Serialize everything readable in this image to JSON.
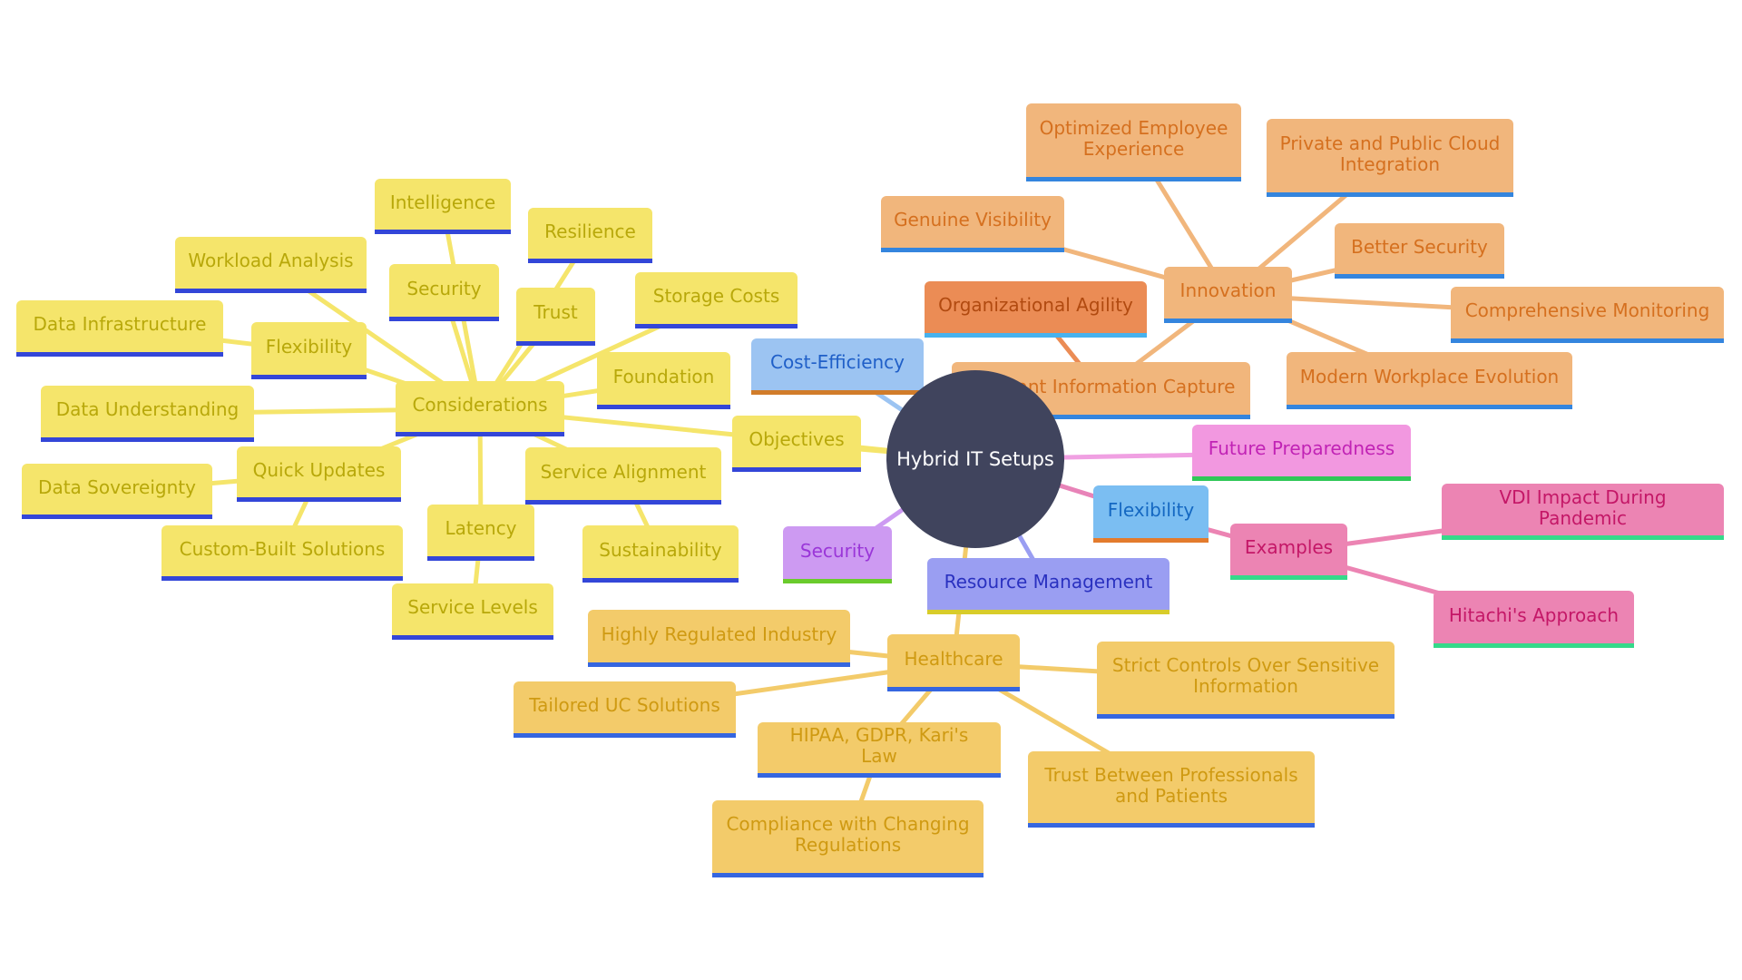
{
  "root": {
    "label": "Hybrid IT Setups"
  },
  "palette": {
    "yellow": {
      "fill": "#f5e56b",
      "text": "#b8a80a",
      "border": "#3346d8",
      "edge": "#f5e56b"
    },
    "gold": {
      "fill": "#f3cb6a",
      "text": "#cf9a12",
      "border": "#3566e0",
      "edge": "#f3cb6a"
    },
    "peach": {
      "fill": "#f1b67c",
      "text": "#d5701f",
      "border": "#3485de",
      "edge": "#f1b67c"
    },
    "orange": {
      "fill": "#eb8c55",
      "text": "#b14a10",
      "border": "#47b2ee",
      "edge": "#eb8c55"
    },
    "lightblue": {
      "fill": "#9cc4f2",
      "text": "#1f5fc8",
      "border": "#d17c2a",
      "edge": "#9cc4f2"
    },
    "skyblue": {
      "fill": "#7bbef2",
      "text": "#1468c2",
      "border": "#e37b2d",
      "edge": "#e883b8"
    },
    "pink": {
      "fill": "#f298e0",
      "text": "#c123b5",
      "border": "#2fc857",
      "edge": "#f0a0e2"
    },
    "rose": {
      "fill": "#ec84b3",
      "text": "#c41767",
      "border": "#35d98a",
      "edge": "#ec84b3"
    },
    "violet": {
      "fill": "#cd9af2",
      "text": "#9a36d8",
      "border": "#6acb2c",
      "edge": "#cd9af2"
    },
    "indigo": {
      "fill": "#9a9ef2",
      "text": "#2a31c0",
      "border": "#d8cc2a",
      "edge": "#9a9ef2"
    }
  },
  "nodes": [
    {
      "id": "considerations",
      "label": "Considerations",
      "parent": "root",
      "color": "yellow"
    },
    {
      "id": "intelligence",
      "label": "Intelligence",
      "parent": "considerations",
      "color": "yellow",
      "via": "security-y"
    },
    {
      "id": "resilience",
      "label": "Resilience",
      "parent": "considerations",
      "color": "yellow",
      "via": "trust"
    },
    {
      "id": "workload-analysis",
      "label": "Workload Analysis",
      "parent": "considerations",
      "color": "yellow"
    },
    {
      "id": "security-y",
      "label": "Security",
      "parent": "considerations",
      "color": "yellow"
    },
    {
      "id": "trust",
      "label": "Trust",
      "parent": "considerations",
      "color": "yellow"
    },
    {
      "id": "storage-costs",
      "label": "Storage Costs",
      "parent": "considerations",
      "color": "yellow"
    },
    {
      "id": "data-infrastructure",
      "label": "Data Infrastructure",
      "parent": "flexibility-y",
      "color": "yellow"
    },
    {
      "id": "flexibility-y",
      "label": "Flexibility",
      "parent": "considerations",
      "color": "yellow"
    },
    {
      "id": "foundation",
      "label": "Foundation",
      "parent": "considerations",
      "color": "yellow"
    },
    {
      "id": "data-understanding",
      "label": "Data Understanding",
      "parent": "considerations",
      "color": "yellow"
    },
    {
      "id": "objectives",
      "label": "Objectives",
      "parent": "root",
      "color": "yellow"
    },
    {
      "id": "quick-updates",
      "label": "Quick Updates",
      "parent": "considerations",
      "color": "yellow"
    },
    {
      "id": "service-alignment",
      "label": "Service Alignment",
      "parent": "considerations",
      "color": "yellow"
    },
    {
      "id": "data-sovereignty",
      "label": "Data Sovereignty",
      "parent": "quick-updates",
      "color": "yellow"
    },
    {
      "id": "custom-built-solutions",
      "label": "Custom-Built Solutions",
      "parent": "quick-updates",
      "color": "yellow"
    },
    {
      "id": "latency",
      "label": "Latency",
      "parent": "considerations",
      "color": "yellow"
    },
    {
      "id": "sustainability",
      "label": "Sustainability",
      "parent": "service-alignment",
      "color": "yellow"
    },
    {
      "id": "service-levels",
      "label": "Service Levels",
      "parent": "latency",
      "color": "yellow"
    },
    {
      "id": "cost-efficiency",
      "label": "Cost-Efficiency",
      "parent": "root",
      "color": "lightblue"
    },
    {
      "id": "organizational-agility",
      "label": "Organizational Agility",
      "parent": "relevant-information-capture",
      "color": "orange"
    },
    {
      "id": "innovation",
      "label": "Innovation",
      "parent": "relevant-information-capture",
      "color": "peach"
    },
    {
      "id": "optimized-employee-experience",
      "label": "Optimized Employee Experience",
      "parent": "innovation",
      "color": "peach"
    },
    {
      "id": "private-public-cloud",
      "label": "Private and Public Cloud Integration",
      "parent": "innovation",
      "color": "peach"
    },
    {
      "id": "genuine-visibility",
      "label": "Genuine Visibility",
      "parent": "innovation",
      "color": "peach"
    },
    {
      "id": "better-security",
      "label": "Better Security",
      "parent": "innovation",
      "color": "peach"
    },
    {
      "id": "comprehensive-monitoring",
      "label": "Comprehensive Monitoring",
      "parent": "innovation",
      "color": "peach"
    },
    {
      "id": "relevant-information-capture",
      "label": "Relevant Information Capture",
      "parent": "root",
      "color": "peach"
    },
    {
      "id": "modern-workplace-evolution",
      "label": "Modern Workplace Evolution",
      "parent": "innovation",
      "color": "peach"
    },
    {
      "id": "future-preparedness",
      "label": "Future Preparedness",
      "parent": "root",
      "color": "pink"
    },
    {
      "id": "flexibility-b",
      "label": "Flexibility",
      "parent": "root",
      "color": "skyblue"
    },
    {
      "id": "examples",
      "label": "Examples",
      "parent": "flexibility-b",
      "color": "rose"
    },
    {
      "id": "vdi-impact",
      "label": "VDI Impact During Pandemic",
      "parent": "examples",
      "color": "rose"
    },
    {
      "id": "hitachis-approach",
      "label": "Hitachi's Approach",
      "parent": "examples",
      "color": "rose"
    },
    {
      "id": "security-p",
      "label": "Security",
      "parent": "root",
      "color": "violet"
    },
    {
      "id": "resource-management",
      "label": "Resource Management",
      "parent": "root",
      "color": "indigo"
    },
    {
      "id": "healthcare",
      "label": "Healthcare",
      "parent": "root",
      "color": "gold"
    },
    {
      "id": "highly-regulated-industry",
      "label": "Highly Regulated Industry",
      "parent": "healthcare",
      "color": "gold"
    },
    {
      "id": "tailored-uc-solutions",
      "label": "Tailored UC Solutions",
      "parent": "healthcare",
      "color": "gold"
    },
    {
      "id": "strict-controls",
      "label": "Strict Controls Over Sensitive Information",
      "parent": "healthcare",
      "color": "gold"
    },
    {
      "id": "hipaa-gdpr-karis-law",
      "label": "HIPAA, GDPR, Kari's Law",
      "parent": "healthcare",
      "color": "gold"
    },
    {
      "id": "trust-between",
      "label": "Trust Between Professionals and Patients",
      "parent": "healthcare",
      "color": "gold"
    },
    {
      "id": "compliance-changing-regulations",
      "label": "Compliance with Changing Regulations",
      "parent": "hipaa-gdpr-karis-law",
      "color": "gold"
    }
  ]
}
